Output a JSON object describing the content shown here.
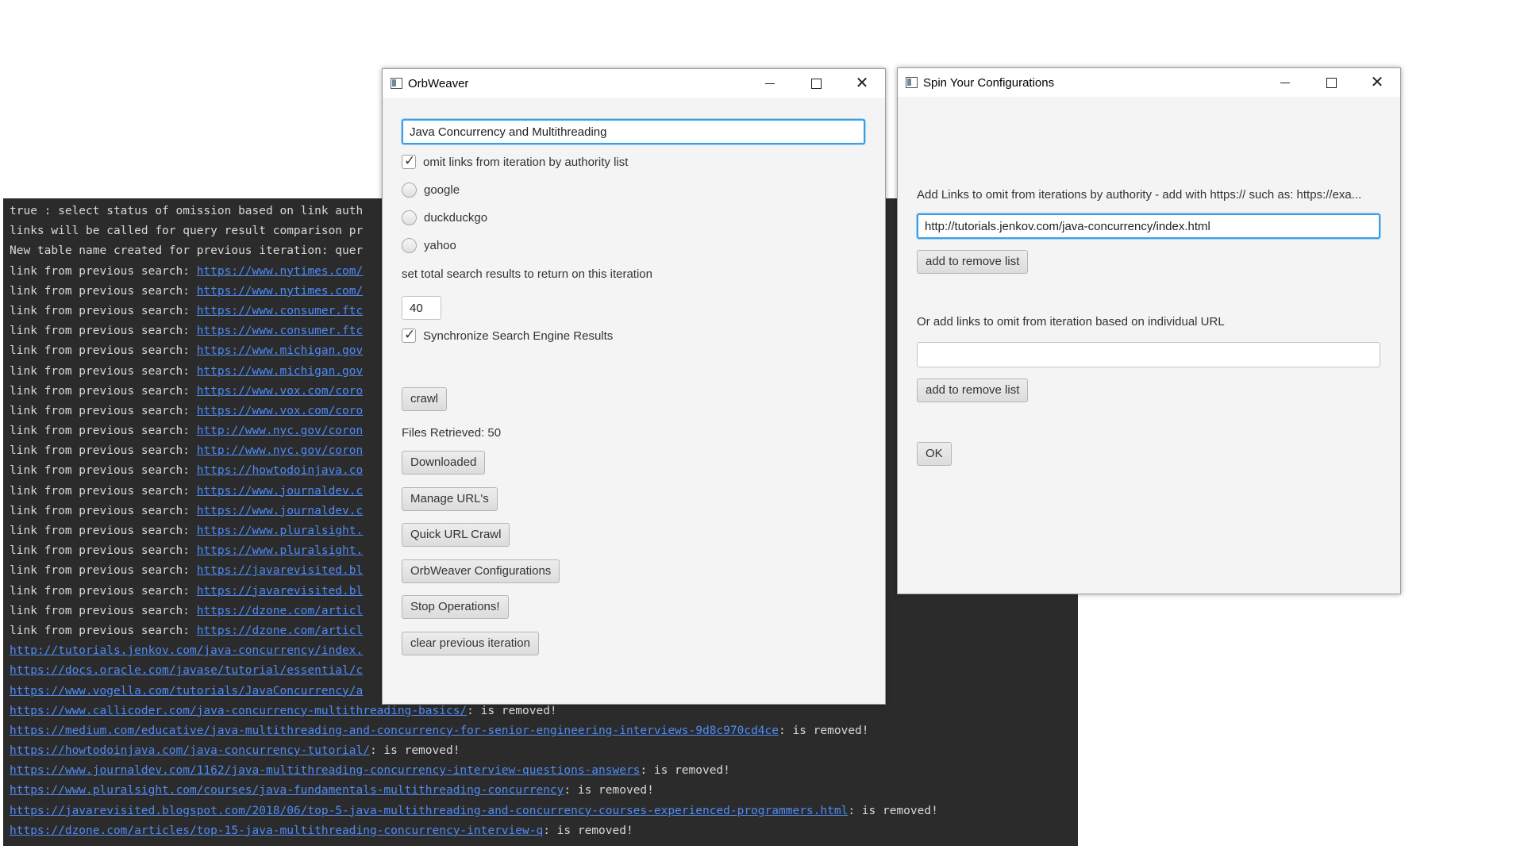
{
  "console": {
    "lines": [
      {
        "text": "true : select status of omission based on link auth",
        "link": "",
        "msg": ""
      },
      {
        "text": "links will be called for query result comparison pr",
        "link": "",
        "msg": ""
      },
      {
        "text": "New table name created for previous iteration: quer",
        "link": "",
        "msg": ""
      },
      {
        "text": "link from previous search: ",
        "link": "https://www.nytimes.com/",
        "msg": ""
      },
      {
        "text": "link from previous search: ",
        "link": "https://www.nytimes.com/",
        "msg": ""
      },
      {
        "text": "link from previous search: ",
        "link": "https://www.consumer.ftc",
        "msg": ""
      },
      {
        "text": "link from previous search: ",
        "link": "https://www.consumer.ftc",
        "msg": ""
      },
      {
        "text": "link from previous search: ",
        "link": "https://www.michigan.gov",
        "msg": ""
      },
      {
        "text": "link from previous search: ",
        "link": "https://www.michigan.gov",
        "msg": ""
      },
      {
        "text": "link from previous search: ",
        "link": "https://www.vox.com/coro",
        "msg": ""
      },
      {
        "text": "link from previous search: ",
        "link": "https://www.vox.com/coro",
        "msg": ""
      },
      {
        "text": "link from previous search: ",
        "link": "http://www.nyc.gov/coron",
        "msg": ""
      },
      {
        "text": "link from previous search: ",
        "link": "http://www.nyc.gov/coron",
        "msg": ""
      },
      {
        "text": "link from previous search: ",
        "link": "https://howtodoinjava.co",
        "msg": ""
      },
      {
        "text": "link from previous search: ",
        "link": "https://www.journaldev.c",
        "msg": ""
      },
      {
        "text": "link from previous search: ",
        "link": "https://www.journaldev.c",
        "msg": ""
      },
      {
        "text": "link from previous search: ",
        "link": "https://www.pluralsight.",
        "msg": ""
      },
      {
        "text": "link from previous search: ",
        "link": "https://www.pluralsight.",
        "msg": ""
      },
      {
        "text": "link from previous search: ",
        "link": "https://javarevisited.bl",
        "msg": ""
      },
      {
        "text": "link from previous search: ",
        "link": "https://javarevisited.bl",
        "msg": ""
      },
      {
        "text": "link from previous search: ",
        "link": "https://dzone.com/articl",
        "msg": ""
      },
      {
        "text": "link from previous search: ",
        "link": "https://dzone.com/articl",
        "msg": ""
      },
      {
        "text": "",
        "link": "http://tutorials.jenkov.com/java-concurrency/index.",
        "msg": ""
      },
      {
        "text": "",
        "link": "https://docs.oracle.com/javase/tutorial/essential/c",
        "msg": ""
      },
      {
        "text": "",
        "link": "https://www.vogella.com/tutorials/JavaConcurrency/a",
        "msg": ""
      },
      {
        "text": "",
        "link": "https://www.callicoder.com/java-concurrency-multithreading-basics/",
        "msg": ": is removed!"
      },
      {
        "text": "",
        "link": "https://medium.com/educative/java-multithreading-and-concurrency-for-senior-engineering-interviews-9d8c970cd4ce",
        "msg": ": is removed!"
      },
      {
        "text": "",
        "link": "https://howtodoinjava.com/java-concurrency-tutorial/",
        "msg": ": is removed!"
      },
      {
        "text": "",
        "link": "https://www.journaldev.com/1162/java-multithreading-concurrency-interview-questions-answers",
        "msg": ": is removed!"
      },
      {
        "text": "",
        "link": "https://www.pluralsight.com/courses/java-fundamentals-multithreading-concurrency",
        "msg": ": is removed!"
      },
      {
        "text": "",
        "link": "https://javarevisited.blogspot.com/2018/06/top-5-java-multithreading-and-concurrency-courses-experienced-programmers.html",
        "msg": ": is removed!"
      },
      {
        "text": "",
        "link": "https://dzone.com/articles/top-15-java-multithreading-concurrency-interview-q",
        "msg": ": is removed!"
      }
    ]
  },
  "orbweaver": {
    "title": "OrbWeaver",
    "query_value": "Java Concurrency and Multithreading",
    "omit_checkbox_label": "omit links from iteration by authority list",
    "omit_checked": true,
    "engines": [
      "google",
      "duckduckgo",
      "yahoo"
    ],
    "results_label": "set total search results to return on this iteration",
    "results_value": "40",
    "sync_label": "Synchronize Search Engine Results",
    "sync_checked": true,
    "crawl_label": "crawl",
    "files_retrieved": "Files Retrieved: 50",
    "downloaded_label": "Downloaded",
    "manage_urls_label": "Manage URL's",
    "quick_crawl_label": "Quick URL Crawl",
    "configurations_label": "OrbWeaver Configurations",
    "stop_label": "Stop Operations!",
    "clear_label": "clear previous iteration"
  },
  "spin": {
    "title": "Spin Your Configurations",
    "authority_label": "Add Links to omit from iterations by authority - add with https:// such as: https://exa...",
    "authority_value": "http://tutorials.jenkov.com/java-concurrency/index.html",
    "add_authority_label": "add to remove list",
    "url_label": "Or add links to omit from iteration based on individual URL",
    "url_value": "",
    "add_url_label": "add to remove list",
    "ok_label": "OK"
  }
}
